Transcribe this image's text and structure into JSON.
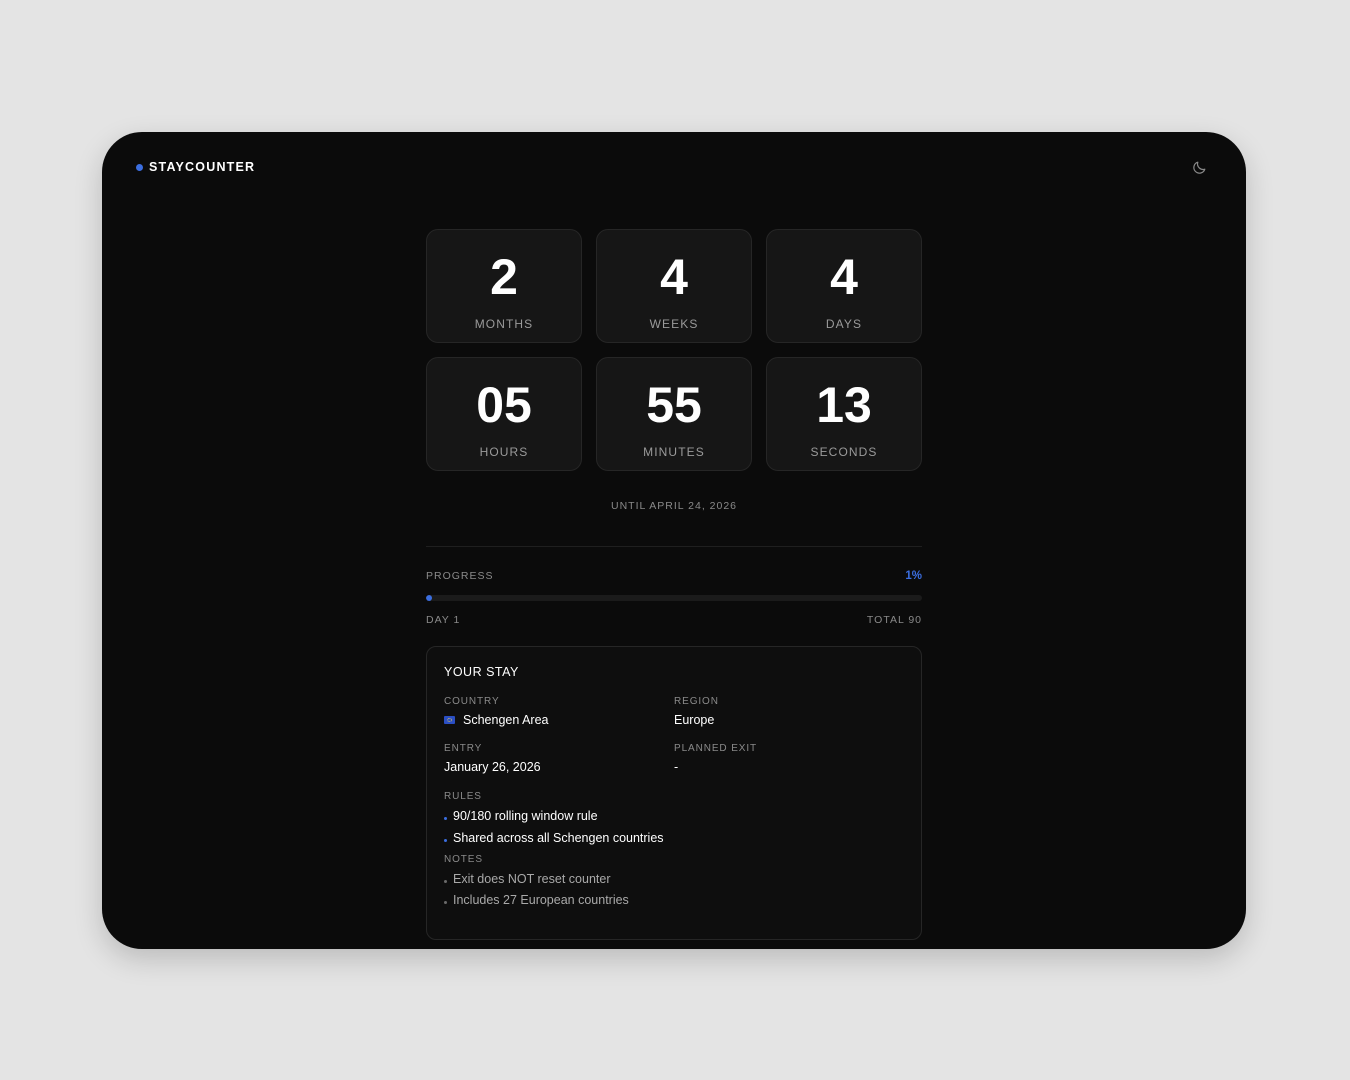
{
  "brand": {
    "name": "STAYCOUNTER"
  },
  "icons": {
    "theme_toggle": "moon-icon",
    "brand_dot": "dot-icon",
    "flag": "eu-flag-icon"
  },
  "colors": {
    "accent": "#3b6ee0",
    "background": "#0b0b0b",
    "tile": "#161616"
  },
  "countdown": [
    {
      "value": "2",
      "label": "MONTHS"
    },
    {
      "value": "4",
      "label": "WEEKS"
    },
    {
      "value": "4",
      "label": "DAYS"
    },
    {
      "value": "05",
      "label": "HOURS"
    },
    {
      "value": "55",
      "label": "MINUTES"
    },
    {
      "value": "13",
      "label": "SECONDS"
    }
  ],
  "until": "UNTIL APRIL 24, 2026",
  "progress": {
    "label": "PROGRESS",
    "percent_text": "1%",
    "percent": 1,
    "start_label": "DAY 1",
    "end_label": "TOTAL 90"
  },
  "stay": {
    "title": "YOUR STAY",
    "country_label": "COUNTRY",
    "country": "Schengen Area",
    "region_label": "REGION",
    "region": "Europe",
    "entry_label": "ENTRY",
    "entry": "January 26, 2026",
    "exit_label": "PLANNED EXIT",
    "exit": "-",
    "rules_label": "RULES",
    "rules": [
      "90/180 rolling window rule",
      "Shared across all Schengen countries"
    ],
    "notes_label": "NOTES",
    "notes": [
      "Exit does NOT reset counter",
      "Includes 27 European countries"
    ]
  }
}
